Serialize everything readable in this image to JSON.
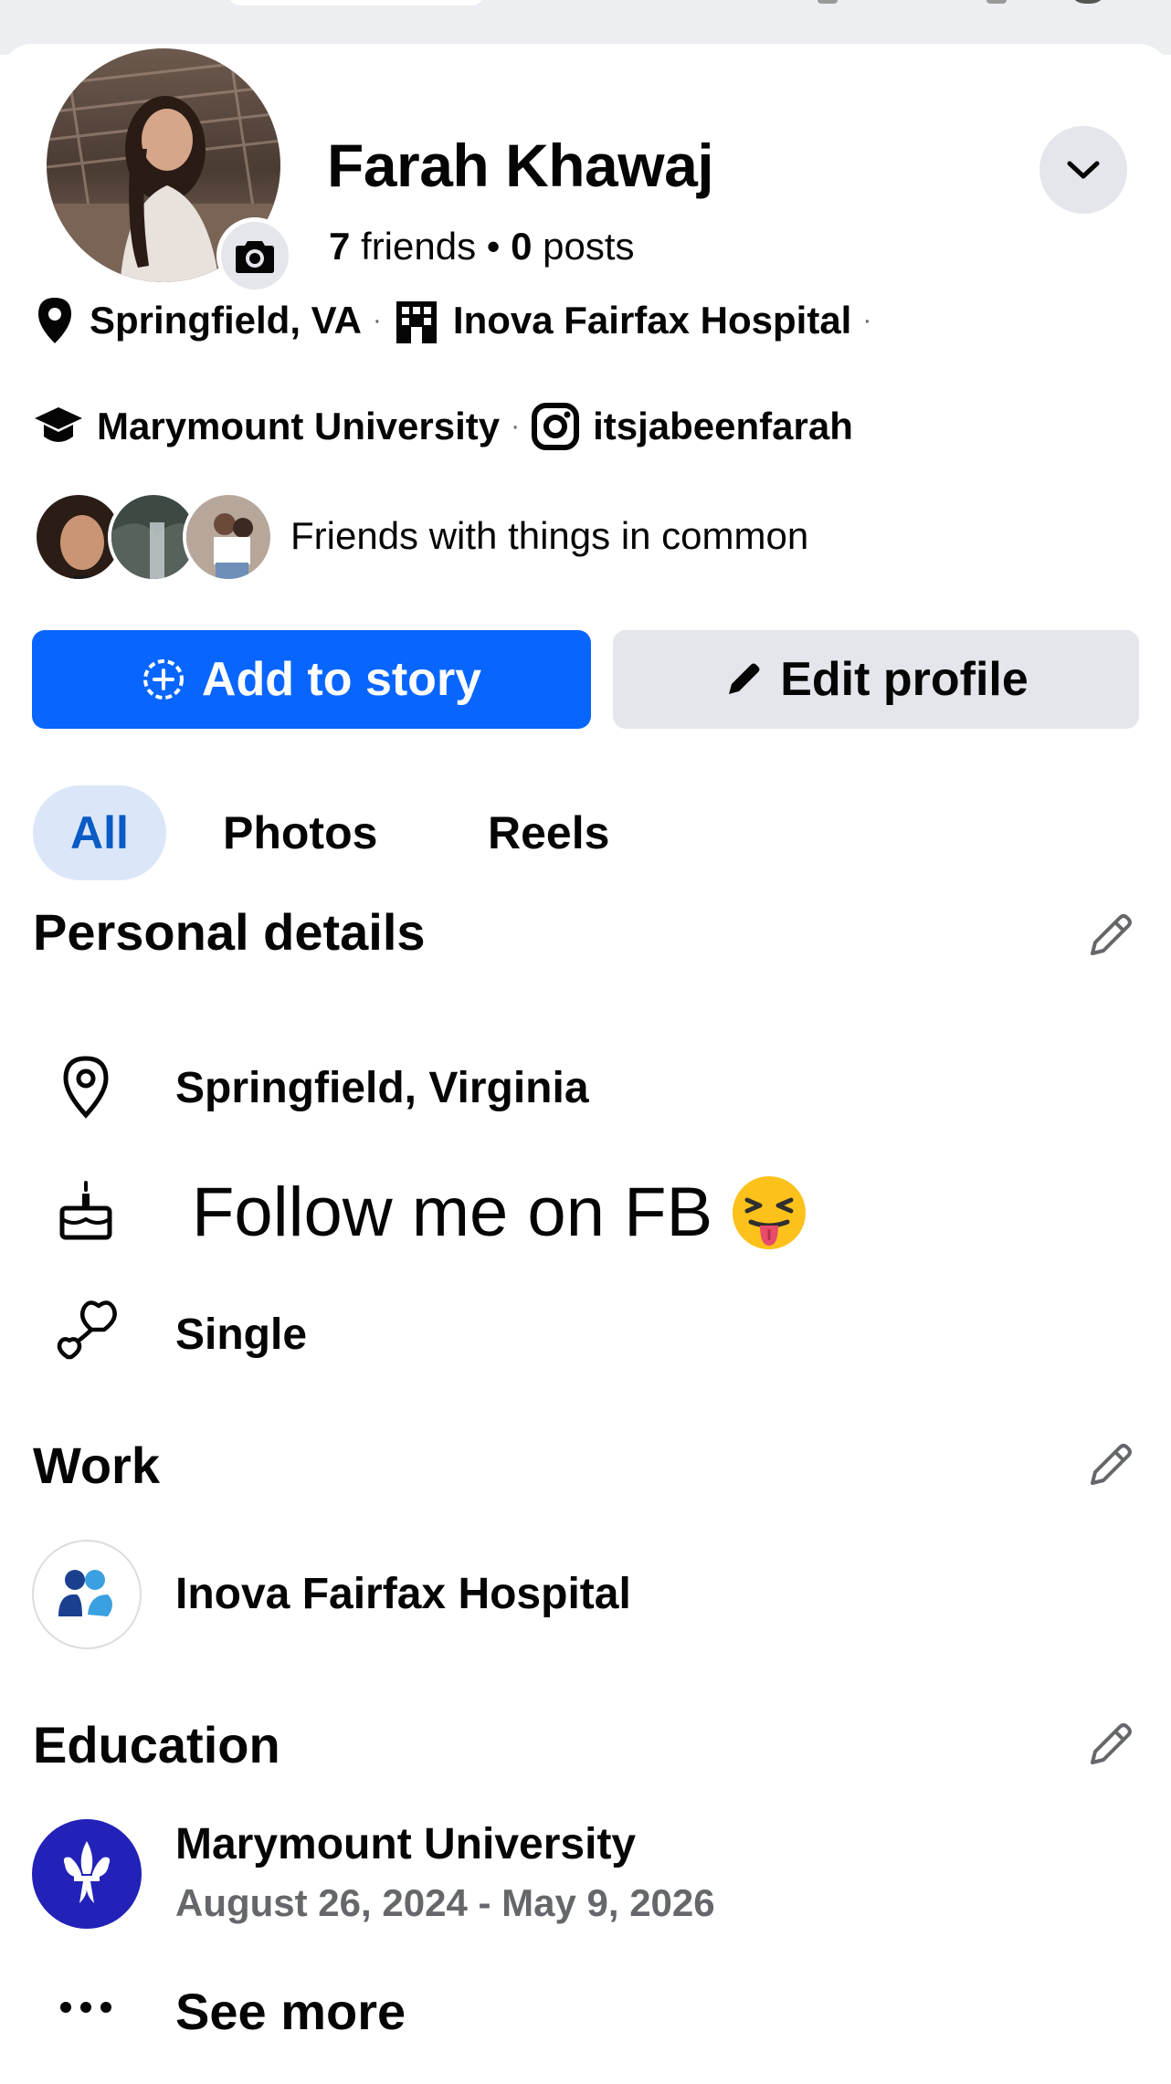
{
  "profile": {
    "name": "Farah Khawaj",
    "friends_count": "7",
    "friends_label": "friends",
    "posts_count": "0",
    "posts_label": "posts"
  },
  "info": {
    "location": "Springfield, VA",
    "workplace": "Inova Fairfax Hospital",
    "school": "Marymount University",
    "instagram": "itsjabeenfarah",
    "separator": "·"
  },
  "mutual_text": "Friends with things in common",
  "actions": {
    "add_story": "Add to story",
    "edit_profile": "Edit profile"
  },
  "tabs": [
    {
      "label": "All",
      "active": true
    },
    {
      "label": "Photos",
      "active": false
    },
    {
      "label": "Reels",
      "active": false
    }
  ],
  "personal_details": {
    "title": "Personal details",
    "location": "Springfield, Virginia",
    "bio": "Follow me on FB",
    "bio_emoji": "😝",
    "relationship": "Single"
  },
  "work": {
    "title": "Work",
    "employer": "Inova Fairfax Hospital"
  },
  "education": {
    "title": "Education",
    "school": "Marymount University",
    "dates": "August 26, 2024 - May 9, 2026"
  },
  "see_more": "See more",
  "colors": {
    "primary": "#0866ff",
    "secondary_bg": "#e4e6eb",
    "tab_active_bg": "#dbe7f9",
    "tab_active_text": "#0a5bc4",
    "university_blue": "#2222b8"
  },
  "icons": {
    "chevron": "chevron-down-icon",
    "camera": "camera-icon",
    "pin": "location-pin-icon",
    "building": "building-icon",
    "cap": "graduation-cap-icon",
    "instagram": "instagram-icon",
    "pencil": "pencil-icon",
    "cake": "cake-icon",
    "hearts": "hearts-icon",
    "dots": "more-dots-icon"
  }
}
